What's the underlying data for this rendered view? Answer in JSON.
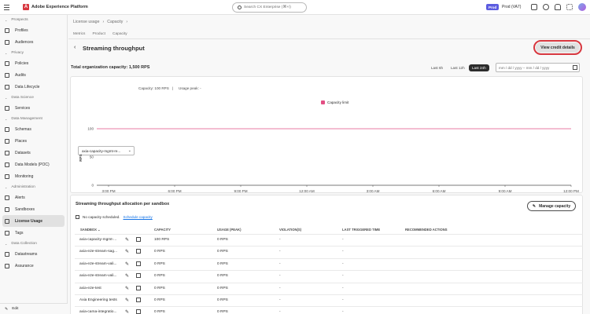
{
  "topbar": {
    "app_title": "Adobe Experience Platform",
    "search_placeholder": "Search CX Enterprise (⌘+/)",
    "env_badge": "Prod",
    "org": "Prod (VA7)"
  },
  "sidebar": {
    "items": [
      {
        "type": "section",
        "label": "Prospects"
      },
      {
        "type": "item",
        "label": "Profiles"
      },
      {
        "type": "item",
        "label": "Audiences"
      },
      {
        "type": "section",
        "label": "Privacy"
      },
      {
        "type": "item",
        "label": "Policies"
      },
      {
        "type": "item",
        "label": "Audits"
      },
      {
        "type": "item",
        "label": "Data Lifecycle"
      },
      {
        "type": "section",
        "label": "Data Science"
      },
      {
        "type": "item",
        "label": "Services"
      },
      {
        "type": "section",
        "label": "Data Management"
      },
      {
        "type": "item",
        "label": "Schemas"
      },
      {
        "type": "item",
        "label": "Places"
      },
      {
        "type": "item",
        "label": "Datasets"
      },
      {
        "type": "item",
        "label": "Data Models (POC)"
      },
      {
        "type": "item",
        "label": "Monitoring"
      },
      {
        "type": "section",
        "label": "Administration"
      },
      {
        "type": "item",
        "label": "Alerts"
      },
      {
        "type": "item",
        "label": "Sandboxes"
      },
      {
        "type": "item",
        "label": "License Usage",
        "active": true
      },
      {
        "type": "item",
        "label": "Tags"
      },
      {
        "type": "section",
        "label": "Data Collection"
      },
      {
        "type": "item",
        "label": "Datastreams"
      },
      {
        "type": "item",
        "label": "Assurance"
      }
    ],
    "edit_label": "Edit"
  },
  "breadcrumb": [
    "License usage",
    "›",
    "Capacity",
    "›"
  ],
  "tabs": [
    "Metrics",
    "Product",
    "Capacity"
  ],
  "page": {
    "title": "Streaming throughput",
    "credit_button": "View credit details",
    "total_capacity": "Total organization capacity: 1,500 RPS",
    "ranges": [
      "Last 6h",
      "Last 12h",
      "Last 24h"
    ],
    "active_range": "Last 24h",
    "date_placeholder": "mm / dd / yyyy  –  mm / dd / yyyy"
  },
  "chart_panel": {
    "sandbox_value": "axia-capacity-mgmt-re...",
    "capacity_text": "Capacity: 100 RPS",
    "separator": "|",
    "usage_peak": "Usage peak: -"
  },
  "chart_data": {
    "type": "line",
    "ylabel": "RPS",
    "ylim": [
      0,
      100
    ],
    "yticks": [
      "0",
      "50",
      "100"
    ],
    "xticks": [
      {
        "label": "3:00 PM",
        "sub": "Aug 13"
      },
      {
        "label": "6:00 PM",
        "sub": ""
      },
      {
        "label": "9:00 PM",
        "sub": ""
      },
      {
        "label": "12:00 AM",
        "sub": "Aug 14"
      },
      {
        "label": "3:00 AM",
        "sub": ""
      },
      {
        "label": "6:00 AM",
        "sub": ""
      },
      {
        "label": "9:00 AM",
        "sub": ""
      },
      {
        "label": "12:00 PM",
        "sub": ""
      }
    ],
    "series": [
      {
        "name": "Capacity limit",
        "constant": 100,
        "color": "#e34f84"
      }
    ]
  },
  "allocation": {
    "title": "Streaming throughput allocation per sandbox",
    "manage_button": "Manage capacity",
    "schedule_text": "No capacity scheduled.",
    "schedule_link": "Schedule capacity",
    "headers": [
      "SANDBOX",
      "CAPACITY",
      "USAGE (PEAK)",
      "VIOLATION(S)",
      "LAST TRIGGERED TIME",
      "RECOMMENDED ACTIONS"
    ],
    "rows": [
      {
        "sandbox": "axia-capacity-mgmt-...",
        "capacity": "100 RPS",
        "usage": "0 RPS",
        "violations": "-",
        "last": "-"
      },
      {
        "sandbox": "axia-e2e-stream-sag...",
        "capacity": "0 RPS",
        "usage": "0 RPS",
        "violations": "-",
        "last": "-"
      },
      {
        "sandbox": "axia-e2e-stream-vali...",
        "capacity": "0 RPS",
        "usage": "0 RPS",
        "violations": "-",
        "last": "-"
      },
      {
        "sandbox": "axia-e2e-stream-vali...",
        "capacity": "0 RPS",
        "usage": "0 RPS",
        "violations": "-",
        "last": "-"
      },
      {
        "sandbox": "axia-e2e-test",
        "capacity": "0 RPS",
        "usage": "0 RPS",
        "violations": "-",
        "last": "-"
      },
      {
        "sandbox": "Axia Engineering tests",
        "capacity": "0 RPS",
        "usage": "0 RPS",
        "violations": "-",
        "last": "-"
      },
      {
        "sandbox": "axia-cama-integratio...",
        "capacity": "0 RPS",
        "usage": "0 RPS",
        "violations": "-",
        "last": "-"
      }
    ]
  }
}
